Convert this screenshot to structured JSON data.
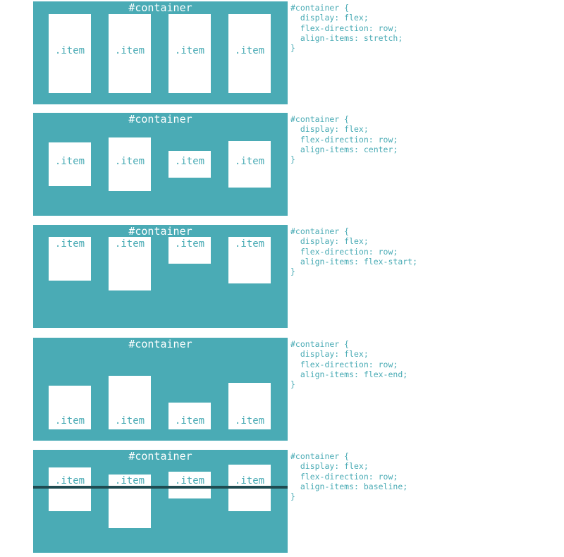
{
  "container_label": "#container",
  "item_label": ".item",
  "colors": {
    "container": "#4aabb5",
    "item": "#ffffff",
    "code": "#4aabb5",
    "baseline": "#1f4a50"
  },
  "examples": [
    {
      "code": "#container {\n  display: flex;\n  flex-direction: row;\n  align-items: stretch;\n}"
    },
    {
      "code": "#container {\n  display: flex;\n  flex-direction: row;\n  align-items: center;\n}"
    },
    {
      "code": "#container {\n  display: flex;\n  flex-direction: row;\n  align-items: flex-start;\n}"
    },
    {
      "code": "#container {\n  display: flex;\n  flex-direction: row;\n  align-items: flex-end;\n}"
    },
    {
      "code": "#container {\n  display: flex;\n  flex-direction: row;\n  align-items: baseline;\n}"
    }
  ]
}
